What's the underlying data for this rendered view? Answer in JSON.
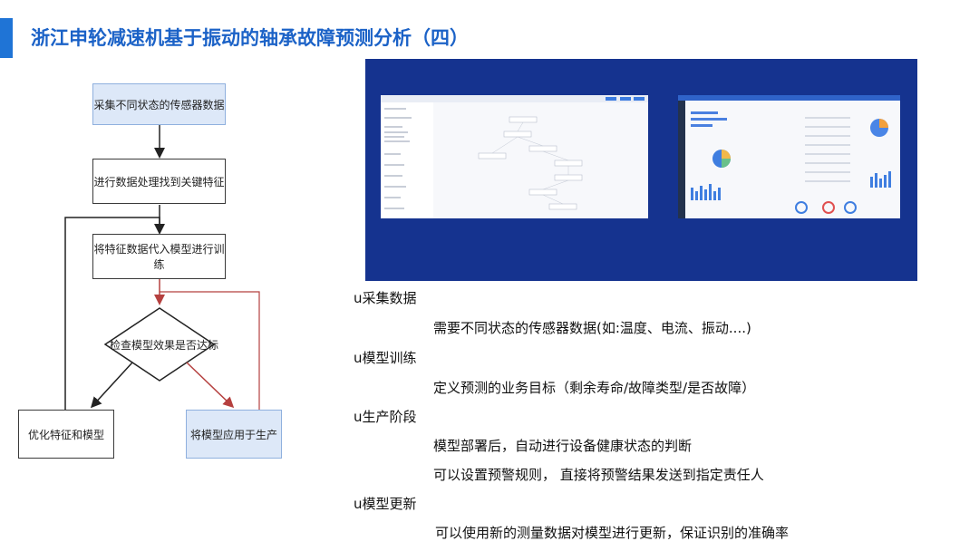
{
  "header": {
    "title": "浙江申轮减速机基于振动的轴承故障预测分析（四）"
  },
  "flowchart": {
    "step1": "采集不同状态的传感器数据",
    "step2": "进行数据处理找到关键特征",
    "step3": "将特征数据代入模型进行训练",
    "decision": "检查模型效果是否达标",
    "no_branch": "优化特征和模型",
    "yes_branch": "将模型应用于生产"
  },
  "colors": {
    "title_blue": "#1b62c7",
    "accent_bar": "#1f74d6",
    "panel_navy": "#15338f",
    "flow_blue_fill": "#dde8f8",
    "loop_red": "#b5403f"
  },
  "sections": [
    {
      "marker": "u",
      "heading": "采集数据",
      "lines": [
        "需要不同状态的传感器数据(如:温度、电流、振动....)"
      ]
    },
    {
      "marker": "u",
      "heading": "模型训练",
      "lines": [
        "定义预测的业务目标（剩余寿命/故障类型/是否故障）"
      ]
    },
    {
      "marker": "u",
      "heading": "生产阶段",
      "lines": [
        "模型部署后，自动进行设备健康状态的判断",
        "可以设置预警规则， 直接将预警结果发送到指定责任人"
      ]
    },
    {
      "marker": "u",
      "heading": "模型更新",
      "lines": [
        "可以使用新的测量数据对模型进行更新，保证识别的准确率"
      ]
    }
  ]
}
